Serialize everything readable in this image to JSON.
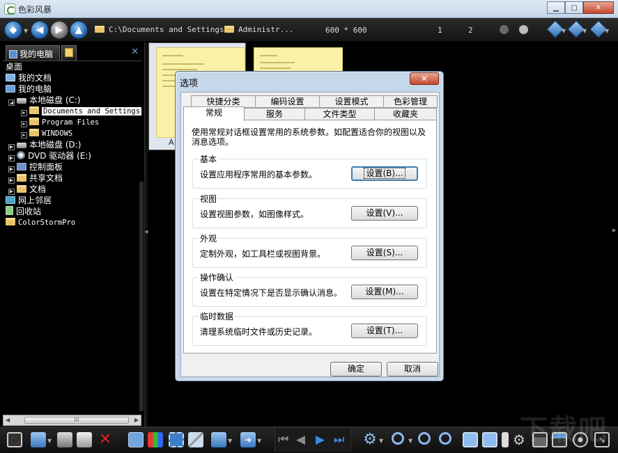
{
  "window": {
    "title": "色彩风暴",
    "minimize": "▁",
    "maximize": "□",
    "close": "✕"
  },
  "toolbar": {
    "path_root": "C:\\Documents and Settings",
    "path_child": "Administr...",
    "image_size": "600 * 600",
    "page_a": "1",
    "page_b": "2"
  },
  "left_panel": {
    "tab_computer": "我的电脑",
    "tree": [
      {
        "label": "桌面",
        "icon": "desktop"
      },
      {
        "label": "我的文档",
        "icon": "docs"
      },
      {
        "label": "我的电脑",
        "icon": "pc"
      },
      {
        "label": "本地磁盘 (C:)",
        "icon": "drive"
      },
      {
        "label": "Documents and Settings",
        "icon": "folder",
        "selected": true
      },
      {
        "label": "Program Files",
        "icon": "folder"
      },
      {
        "label": "WINDOWS",
        "icon": "folder"
      },
      {
        "label": "本地磁盘 (D:)",
        "icon": "drive"
      },
      {
        "label": "DVD 驱动器 (E:)",
        "icon": "dvd"
      },
      {
        "label": "控制面板",
        "icon": "control-panel"
      },
      {
        "label": "共享文档",
        "icon": "folder"
      },
      {
        "label": "文档",
        "icon": "folder"
      },
      {
        "label": "网上邻居",
        "icon": "network"
      },
      {
        "label": "回收站",
        "icon": "recycle-bin"
      },
      {
        "label": "ColorStormPro",
        "icon": "folder"
      }
    ],
    "scroll_grip": "III"
  },
  "thumbnails": [
    {
      "caption": "A"
    },
    {
      "caption": ""
    }
  ],
  "dialog": {
    "title": "选项",
    "close": "✕",
    "tabs_row1": [
      "快捷分类",
      "编码设置",
      "设置模式",
      "色彩管理"
    ],
    "tabs_row2": [
      "常规",
      "服务",
      "文件类型",
      "收藏夹"
    ],
    "active_tab": "常规",
    "intro": "使用常规对话框设置常用的系统参数。如配置适合你的视图以及消息选项。",
    "groups": [
      {
        "title": "基本",
        "desc": "设置应用程序常用的基本参数。",
        "button": "设置(B)..."
      },
      {
        "title": "视图",
        "desc": "设置视图参数，如图像样式。",
        "button": "设置(V)..."
      },
      {
        "title": "外观",
        "desc": "定制外观，如工具栏或视图背景。",
        "button": "设置(S)..."
      },
      {
        "title": "操作确认",
        "desc": "设置在特定情况下是否显示确认消息。",
        "button": "设置(M)..."
      },
      {
        "title": "临时数据",
        "desc": "清理系统临时文件或历史记录。",
        "button": "设置(T)..."
      }
    ],
    "ok": "确定",
    "cancel": "取消"
  },
  "watermark": "下载吧",
  "colors": {
    "toolbar_bg": "#1a1a1a",
    "accent_blue": "#2c6db5",
    "dialog_frame": "#c7d7ea",
    "thumb_bg": "#fbf1a6"
  }
}
